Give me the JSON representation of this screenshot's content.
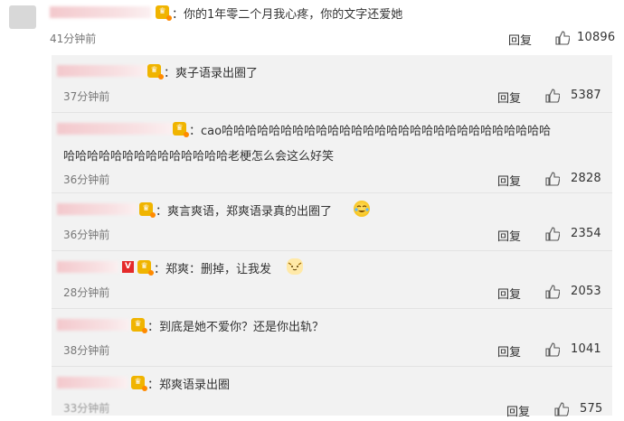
{
  "top_comment": {
    "text": "：你的1年零二个月我心疼，你的文字还爱她",
    "time": "41分钟前",
    "reply_label": "回复",
    "likes": "10896"
  },
  "replies": [
    {
      "text": "：爽子语录出圈了",
      "time": "37分钟前",
      "reply_label": "回复",
      "likes": "5387"
    },
    {
      "text_line1": "：cao哈哈哈哈哈哈哈哈哈哈哈哈哈哈哈哈哈哈哈哈哈哈哈哈哈哈哈哈",
      "text_line2": "哈哈哈哈哈哈哈哈哈哈哈哈哈哈老梗怎么会这么好笑",
      "time": "36分钟前",
      "reply_label": "回复",
      "likes": "2828"
    },
    {
      "text": "：爽言爽语，郑爽语录真的出圈了",
      "time": "36分钟前",
      "reply_label": "回复",
      "likes": "2354"
    },
    {
      "text": "：郑爽：删掉，让我发",
      "time": "28分钟前",
      "reply_label": "回复",
      "likes": "2053"
    },
    {
      "text": "：到底是她不爱你？还是你出轨？",
      "time": "38分钟前",
      "reply_label": "回复",
      "likes": "1041"
    },
    {
      "text": "：郑爽语录出圈",
      "time": "33分钟前",
      "reply_label": "回复",
      "likes": "575"
    }
  ],
  "icons": {
    "thumb": "thumbs-up-icon",
    "member_badge": "vip-crown-badge-icon",
    "verified_badge": "v-verified-icon",
    "laugh_emoji": "laughing-tears-emoji",
    "cat_emoji": "smug-cat-emoji"
  },
  "colors": {
    "panel_bg": "#f2f2f2",
    "badge": "#f0b400",
    "verified": "#e42a2a"
  }
}
